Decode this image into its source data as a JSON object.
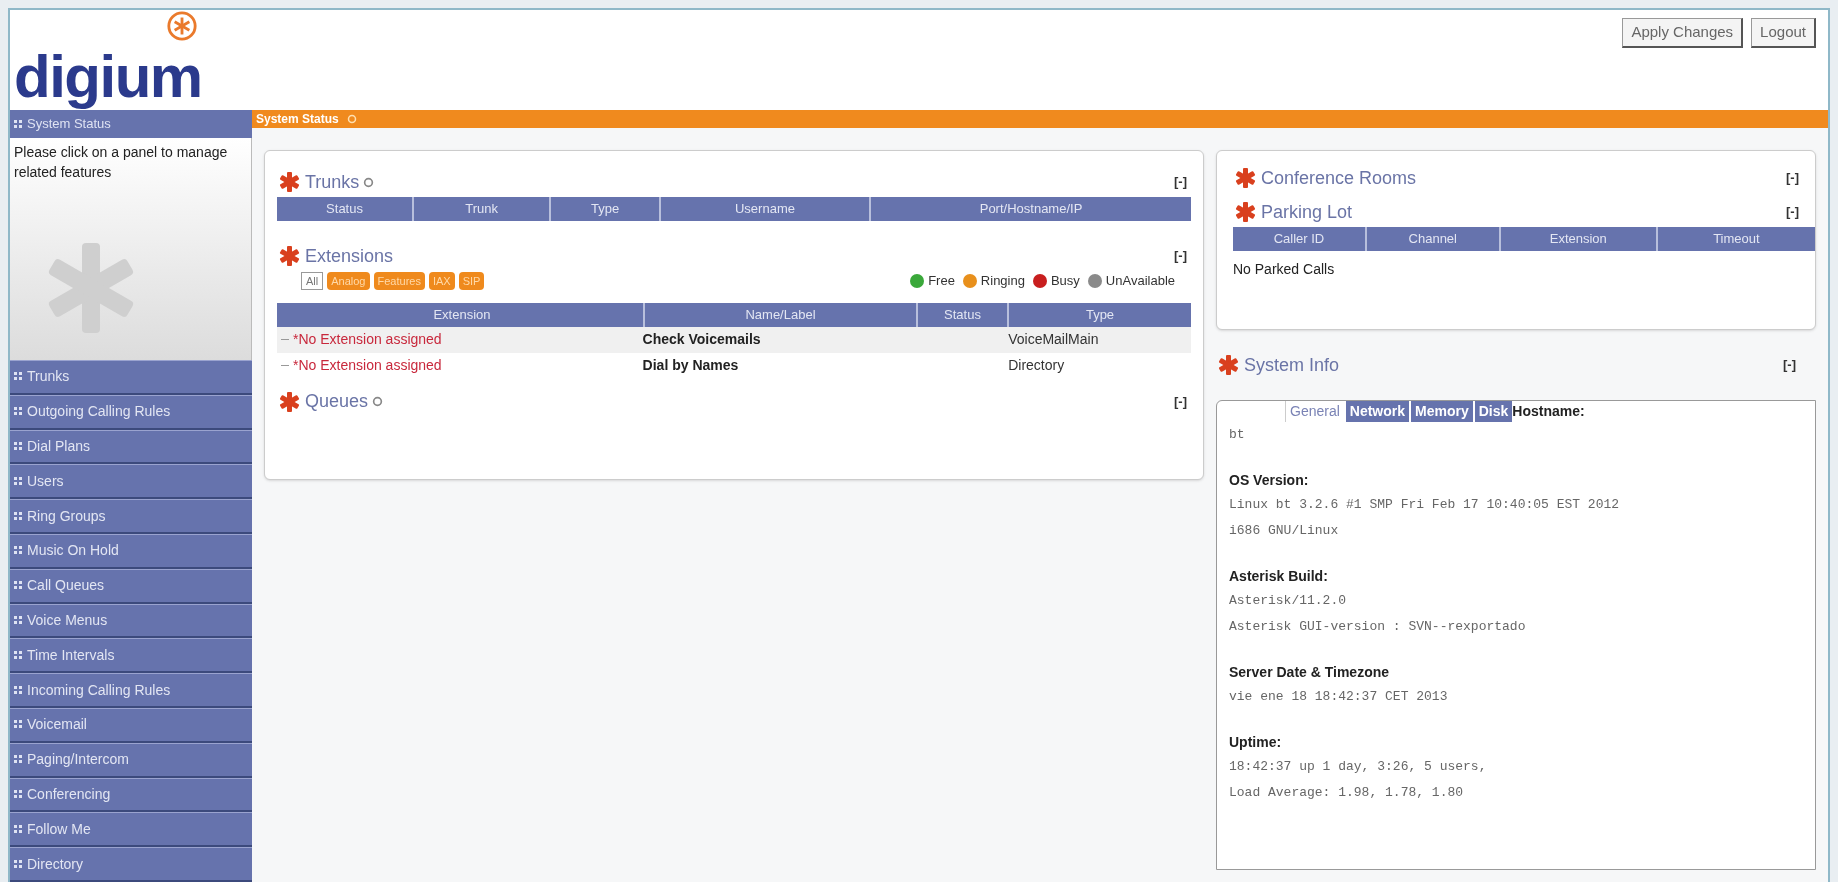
{
  "header": {
    "logo": "digium",
    "buttons": [
      "Apply Changes",
      "Logout"
    ]
  },
  "sidebar": {
    "title": "System Status",
    "description": "Please click on a panel to manage related features",
    "items": [
      {
        "label": "Trunks"
      },
      {
        "label": "Outgoing Calling Rules"
      },
      {
        "label": "Dial Plans"
      },
      {
        "label": "Users"
      },
      {
        "label": "Ring Groups"
      },
      {
        "label": "Music On Hold"
      },
      {
        "label": "Call Queues"
      },
      {
        "label": "Voice Menus"
      },
      {
        "label": "Time Intervals"
      },
      {
        "label": "Incoming Calling Rules"
      },
      {
        "label": "Voicemail"
      },
      {
        "label": "Paging/Intercom"
      },
      {
        "label": "Conferencing"
      },
      {
        "label": "Follow Me"
      },
      {
        "label": "Directory"
      }
    ]
  },
  "page_title": "System Status",
  "left_panel": {
    "trunks": {
      "title": "Trunks",
      "collapse": "[-]",
      "columns": [
        "Status",
        "Trunk",
        "Type",
        "Username",
        "Port/Hostname/IP"
      ]
    },
    "extensions": {
      "title": "Extensions",
      "collapse": "[-]",
      "filters": [
        {
          "label": "All",
          "selected": true
        },
        {
          "label": "Analog",
          "selected": false
        },
        {
          "label": "Features",
          "selected": false
        },
        {
          "label": "IAX",
          "selected": false
        },
        {
          "label": "SIP",
          "selected": false
        }
      ],
      "legend": [
        {
          "label": "Free",
          "color": "#3aa83a"
        },
        {
          "label": "Ringing",
          "color": "#e8901c"
        },
        {
          "label": "Busy",
          "color": "#c81e1e"
        },
        {
          "label": "UnAvailable",
          "color": "#8a8a8a"
        }
      ],
      "columns": [
        "Extension",
        "Name/Label",
        "Status",
        "Type"
      ],
      "rows": [
        {
          "extension": "*No Extension assigned",
          "name": "Check Voicemails",
          "type": "VoiceMailMain"
        },
        {
          "extension": "*No Extension assigned",
          "name": "Dial by Names",
          "type": "Directory"
        }
      ]
    },
    "queues": {
      "title": "Queues",
      "collapse": "[-]"
    }
  },
  "right_panel": {
    "conference": {
      "title": "Conference Rooms",
      "collapse": "[-]"
    },
    "parking": {
      "title": "Parking Lot",
      "collapse": "[-]",
      "columns": [
        "Caller ID",
        "Channel",
        "Extension",
        "Timeout"
      ],
      "empty": "No Parked Calls"
    },
    "system_info": {
      "title": "System Info",
      "collapse": "[-]",
      "tabs": [
        {
          "label": "General",
          "selected": true
        },
        {
          "label": "Network",
          "selected": false
        },
        {
          "label": "Memory",
          "selected": false
        },
        {
          "label": "Disk",
          "selected": false
        }
      ],
      "sections": [
        {
          "label": "Hostname:",
          "lines": [
            "bt"
          ]
        },
        {
          "label": "OS Version:",
          "lines": [
            "Linux bt 3.2.6 #1 SMP Fri Feb 17 10:40:05 EST 2012",
            "i686 GNU/Linux"
          ]
        },
        {
          "label": "Asterisk Build:",
          "lines": [
            "Asterisk/11.2.0",
            "Asterisk GUI-version : SVN--rexportado"
          ]
        },
        {
          "label": "Server Date & Timezone",
          "lines": [
            "vie ene 18 18:42:37 CET 2013"
          ]
        },
        {
          "label": "Uptime:",
          "lines": [
            "18:42:37 up 1 day, 3:26, 5 users,",
            "Load Average: 1.98, 1.78, 1.80"
          ]
        }
      ]
    }
  }
}
